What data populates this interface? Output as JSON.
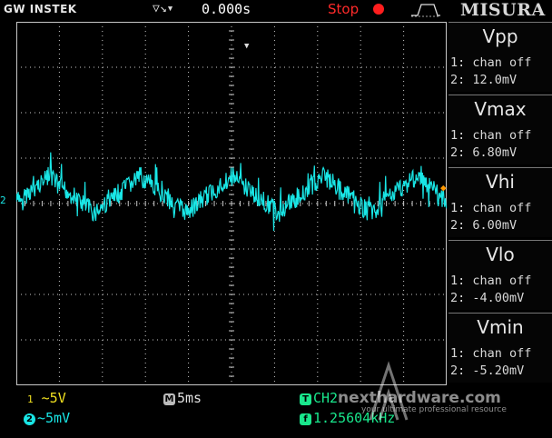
{
  "header": {
    "brand": "GW INSTEK",
    "trigger_icon": "trigger-arrow-icon",
    "time_position": "0.000s",
    "status": "Stop",
    "status_color": "#ff2a2a",
    "edge_icon": "rising-edge-icon",
    "overlay_title": "MISURA"
  },
  "screen": {
    "background": "#000000",
    "grid_color": "#c8c8c8",
    "ch2_marker": "2",
    "trace_color": "#19e6e6",
    "trigger_marker_color": "#ff9900"
  },
  "measurements": [
    {
      "title": "Vpp",
      "ch1": "1: chan off",
      "ch2": "2: 12.0mV"
    },
    {
      "title": "Vmax",
      "ch1": "1: chan off",
      "ch2": "2: 6.80mV"
    },
    {
      "title": "Vhi",
      "ch1": "1: chan off",
      "ch2": "2: 6.00mV"
    },
    {
      "title": "Vlo",
      "ch1": "1: chan off",
      "ch2": "2: -4.00mV"
    },
    {
      "title": "Vmin",
      "ch1": "1: chan off",
      "ch2": "2: -5.20mV"
    }
  ],
  "status_bar": {
    "ch1_badge": "1",
    "ch1_scale": "~5V",
    "ch2_badge": "2",
    "ch2_scale": "~5mV",
    "timebase_badge": "M",
    "timebase": "5ms",
    "trigger_badge": "T",
    "trigger_source": "CH2",
    "freq_badge": "f",
    "frequency": "1.25604kHz"
  },
  "watermark": {
    "site": "nexthardware.com",
    "tagline": "your ultimate professional resource"
  }
}
